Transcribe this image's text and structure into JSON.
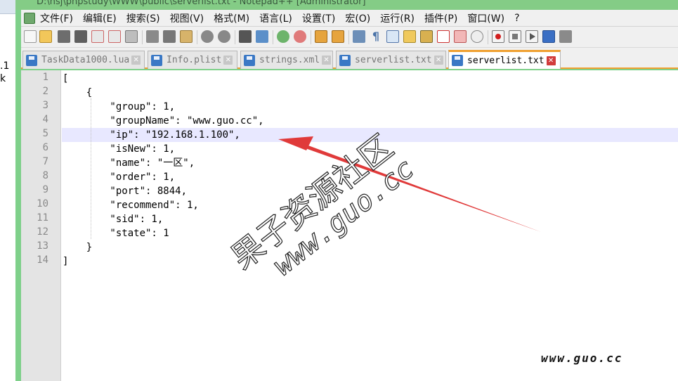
{
  "left_fragments": {
    "a": ".1",
    "b": "k"
  },
  "window": {
    "title": "D:\\hsj\\phpstudy\\WWW\\public\\serverlist.txt - Notepad++ [Administrator]"
  },
  "menu": {
    "items": [
      "文件(F)",
      "编辑(E)",
      "搜索(S)",
      "视图(V)",
      "格式(M)",
      "语言(L)",
      "设置(T)",
      "宏(O)",
      "运行(R)",
      "插件(P)",
      "窗口(W)",
      "?"
    ]
  },
  "toolbar": {
    "icons": [
      "new-file-icon",
      "open-file-icon",
      "save-icon",
      "save-all-icon",
      "close-icon",
      "close-all-icon",
      "print-icon",
      "cut-icon",
      "copy-icon",
      "paste-icon",
      "undo-icon",
      "redo-icon",
      "find-icon",
      "replace-icon",
      "zoom-in-icon",
      "zoom-out-icon",
      "sync-vertical-icon",
      "sync-horizontal-icon",
      "word-wrap-icon",
      "show-all-chars-icon",
      "indent-guide-icon",
      "user-lang-icon",
      "doc-map-icon",
      "function-list-icon",
      "folder-workspace-icon",
      "monitoring-icon",
      "record-macro-icon",
      "stop-record-icon",
      "play-macro-icon",
      "run-macro-multiple-icon",
      "save-macro-icon"
    ]
  },
  "tabs": [
    {
      "label": "TaskData1000.lua",
      "active": false
    },
    {
      "label": "Info.plist",
      "active": false
    },
    {
      "label": "strings.xml",
      "active": false
    },
    {
      "label": "serverlist.txt",
      "active": false
    },
    {
      "label": "serverlist.txt",
      "active": true
    }
  ],
  "editor": {
    "line_numbers": [
      "1",
      "2",
      "3",
      "4",
      "5",
      "6",
      "7",
      "8",
      "9",
      "10",
      "11",
      "12",
      "13",
      "14"
    ],
    "lines": [
      "[",
      "    {",
      "        \"group\": 1,",
      "        \"groupName\": \"www.guo.cc\",",
      "        \"ip\": \"192.168.1.100\",",
      "        \"isNew\": 1,",
      "        \"name\": \"一区\",",
      "        \"order\": 1,",
      "        \"port\": 8844,",
      "        \"recommend\": 1,",
      "        \"sid\": 1,",
      "        \"state\": 1",
      "    }",
      "]"
    ],
    "highlighted_line": 5
  },
  "watermark": {
    "cn": "果子资源社区",
    "url": "www.guo.cc"
  },
  "footer_watermark": "www.guo.cc",
  "colors": {
    "accent_tab": "#f0a030",
    "frame": "#7fd08a",
    "arrow": "#e03a3a",
    "highlight": "#e8e8ff"
  }
}
